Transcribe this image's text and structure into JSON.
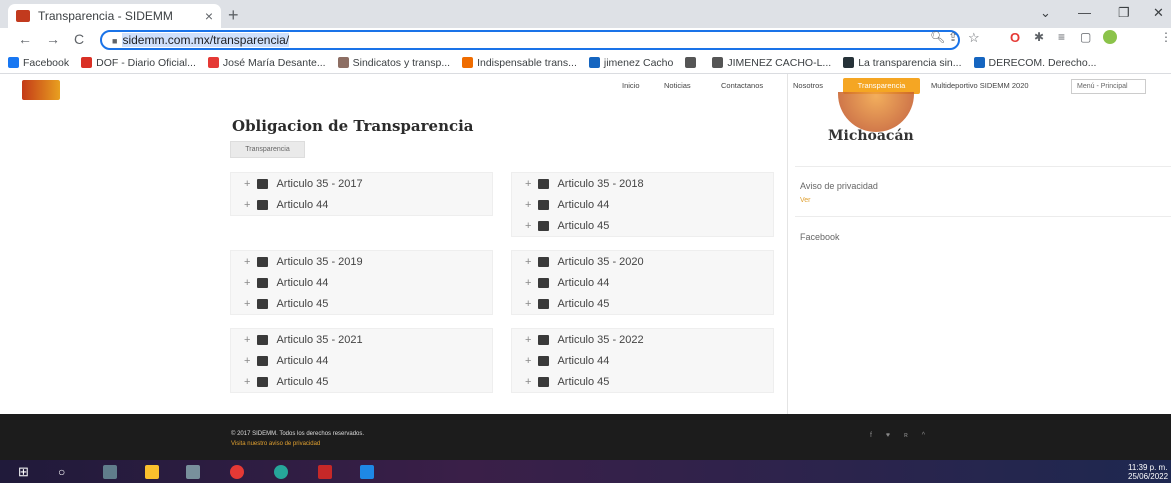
{
  "browser": {
    "tab_title": "Transparencia - SIDEMM",
    "tab_close": "×",
    "new_tab": "+",
    "back": "←",
    "forward": "→",
    "reload": "C",
    "url": "sidemm.com.mx/transparencia/"
  },
  "bookmarks": [
    {
      "label": "Facebook",
      "color": "#1877f2"
    },
    {
      "label": "DOF - Diario Oficial...",
      "color": "#d93025"
    },
    {
      "label": "José María Desante...",
      "color": "#e53935"
    },
    {
      "label": "Sindicatos y transp...",
      "color": "#8d6e63"
    },
    {
      "label": "Indispensable trans...",
      "color": "#ef6c00"
    },
    {
      "label": "jimenez Cacho",
      "color": "#1565c0"
    },
    {
      "label": "",
      "color": "#555555"
    },
    {
      "label": "JIMENEZ CACHO-L...",
      "color": "#555555"
    },
    {
      "label": "La transparencia sin...",
      "color": "#263238"
    },
    {
      "label": "DERECOM. Derecho...",
      "color": "#1565c0"
    }
  ],
  "site": {
    "menu": [
      "Inicio",
      "Noticias",
      "Contactanos",
      "Nosotros",
      "Transparencia",
      "Multideportivo SIDEMM 2020"
    ],
    "menu_select": "Menú - Principal",
    "page_title": "Obligacion de Transparencia",
    "breadcrumb_button": "Transparencia",
    "groups": [
      {
        "items": [
          "Articulo 35 - 2017",
          "Articulo 44"
        ]
      },
      {
        "items": [
          "Articulo 35 - 2018",
          "Articulo 44",
          "Articulo 45"
        ]
      },
      {
        "items": [
          "Articulo 35 - 2019",
          "Articulo 44",
          "Articulo 45"
        ]
      },
      {
        "items": [
          "Articulo 35 - 2020",
          "Articulo 44",
          "Articulo 45"
        ]
      },
      {
        "items": [
          "Articulo 35 - 2021",
          "Articulo 44",
          "Articulo 45"
        ]
      },
      {
        "items": [
          "Articulo 35 - 2022",
          "Articulo 44",
          "Articulo 45"
        ]
      }
    ],
    "sidebar": {
      "heading": "Michoacán",
      "aviso": "Aviso de privacidad",
      "ver": "Ver",
      "facebook": "Facebook"
    },
    "footer": {
      "copyright": "© 2017 SIDEMM. Todos los derechos reservados.",
      "privacy_link": "Visita nuestro aviso de privacidad"
    }
  },
  "taskbar": {
    "time": "11:39 p. m.",
    "date": "25/06/2022"
  },
  "colors": {
    "accent": "#f5a623",
    "footer": "#1c1c1c",
    "address_border": "#1a73e8"
  }
}
